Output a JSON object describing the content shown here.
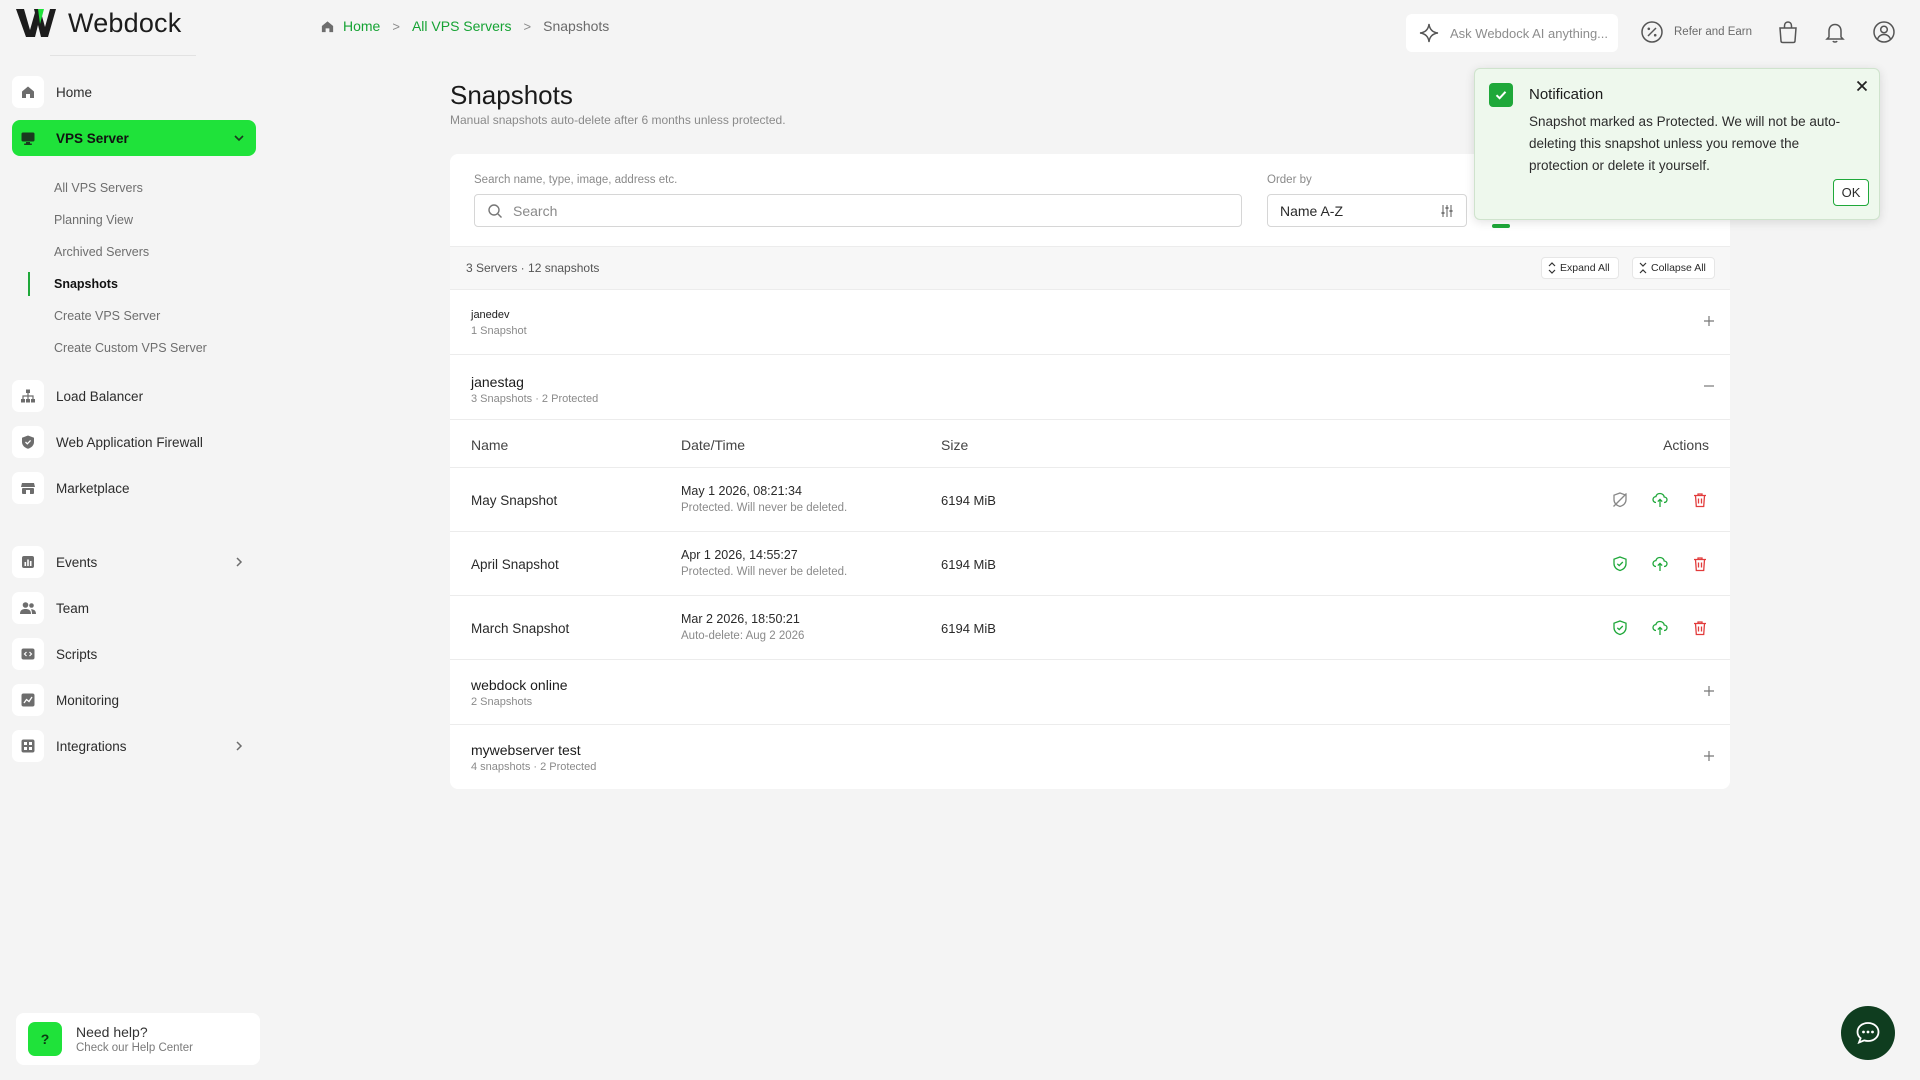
{
  "app": {
    "logo_text": "Webdock"
  },
  "colors": {
    "brand_green": "#1fe23a",
    "link_green": "#16a334",
    "danger_red": "#e23b3b",
    "chat_dark": "#0f3d1f"
  },
  "sidebar": {
    "items": [
      {
        "label": "Home",
        "icon": "home-icon"
      },
      {
        "label": "VPS Server",
        "icon": "monitor-icon",
        "active": true,
        "expanded": true
      },
      {
        "label": "Load Balancer",
        "icon": "sitemap-icon"
      },
      {
        "label": "Web Application Firewall",
        "icon": "shield-icon"
      },
      {
        "label": "Marketplace",
        "icon": "store-icon"
      },
      {
        "label": "Events",
        "icon": "chart-icon",
        "has_submenu": true
      },
      {
        "label": "Team",
        "icon": "users-icon"
      },
      {
        "label": "Scripts",
        "icon": "code-icon"
      },
      {
        "label": "Monitoring",
        "icon": "monitoring-icon"
      },
      {
        "label": "Integrations",
        "icon": "grid-icon",
        "has_submenu": true
      }
    ],
    "vps_submenu": [
      {
        "label": "All VPS Servers"
      },
      {
        "label": "Planning View"
      },
      {
        "label": "Archived Servers"
      },
      {
        "label": "Snapshots",
        "current": true
      },
      {
        "label": "Create VPS Server"
      },
      {
        "label": "Create Custom VPS Server"
      }
    ],
    "help": {
      "badge": "?",
      "title": "Need help?",
      "subtitle": "Check our Help Center"
    }
  },
  "breadcrumb": {
    "home": "Home",
    "level2": "All VPS Servers",
    "current": "Snapshots",
    "separator": ">"
  },
  "topbar": {
    "ai_placeholder": "Ask Webdock AI anything...",
    "refer_label": "Refer and Earn"
  },
  "page": {
    "title": "Snapshots",
    "subtitle": "Manual snapshots auto-delete after 6 months unless protected."
  },
  "filters": {
    "search_label": "Search name, type, image, address etc.",
    "search_placeholder": "Search",
    "order_label": "Order by",
    "order_value": "Name A-Z"
  },
  "summary": {
    "text": "3 Servers · 12 snapshots",
    "expand_all": "Expand All",
    "collapse_all": "Collapse All"
  },
  "groups": [
    {
      "name": "janedev",
      "meta": "1 Snapshot",
      "expanded": false
    },
    {
      "name": "janestag",
      "meta": "3 Snapshots · 2 Protected",
      "expanded": true
    },
    {
      "name": "webdock online",
      "meta": "2 Snapshots",
      "expanded": false
    },
    {
      "name": "mywebserver test",
      "meta": "4 snapshots · 2 Protected",
      "expanded": false
    }
  ],
  "table": {
    "headers": {
      "name": "Name",
      "datetime": "Date/Time",
      "size": "Size",
      "actions": "Actions"
    },
    "rows": [
      {
        "name": "May Snapshot",
        "date": "May 1 2026, 08:21:34",
        "note": "Protected. Will never be deleted.",
        "size": "6194 MiB",
        "protect_icon": "shield-off-icon"
      },
      {
        "name": "April Snapshot",
        "date": "Apr 1 2026, 14:55:27",
        "note": "Protected. Will never be deleted.",
        "size": "6194 MiB",
        "protect_icon": "shield-check-icon"
      },
      {
        "name": "March Snapshot",
        "date": "Mar 2 2026, 18:50:21",
        "note": "Auto-delete: Aug 2 2026",
        "size": "6194 MiB",
        "protect_icon": "shield-check-icon"
      }
    ]
  },
  "notification": {
    "title": "Notification",
    "body": "Snapshot marked as Protected. We will not be auto-deleting this snapshot unless you remove the protection or delete it yourself.",
    "ok_label": "OK"
  }
}
